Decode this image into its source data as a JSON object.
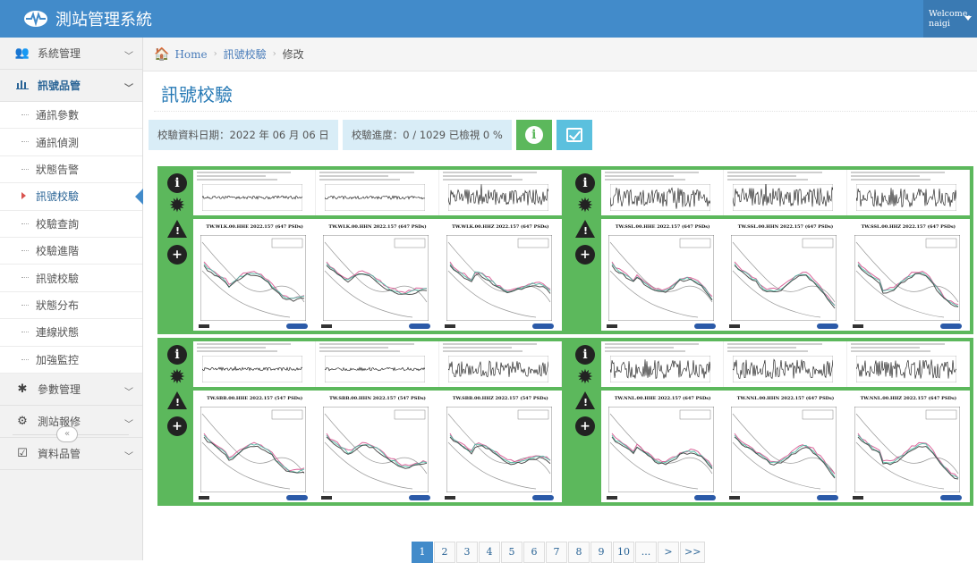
{
  "app": {
    "title": "測站管理系統",
    "welcome_line1": "Welcome,",
    "welcome_line2": "naigi"
  },
  "sidebar": {
    "groups": [
      {
        "label": "系統管理",
        "icon": "users-icon"
      },
      {
        "label": "訊號品管",
        "icon": "bar-chart-icon",
        "active": true
      },
      {
        "label": "參數管理",
        "icon": "asterisk-icon"
      },
      {
        "label": "測站報修",
        "icon": "cogs-icon"
      },
      {
        "label": "資料品管",
        "icon": "check-square-icon"
      }
    ],
    "subitems": [
      "通訊參數",
      "通訊偵測",
      "狀態告警",
      "訊號校驗",
      "校驗查詢",
      "校驗進階",
      "訊號校驗",
      "狀態分布",
      "連線狀態",
      "加強監控"
    ],
    "active_subitem": "訊號校驗",
    "collapse_glyph": "«"
  },
  "breadcrumb": {
    "home": "Home",
    "level1": "訊號校驗",
    "level2": "修改"
  },
  "page": {
    "title": "訊號校驗",
    "date_label": "校驗資料日期：2022 年 06 月 06 日",
    "progress_label": "校驗進度：0 / 1029 已檢視 0 %",
    "info_glyph": "i"
  },
  "cards": [
    {
      "titles": [
        "TW.WLK.00.HHE  2022.157  (647 PSDs)",
        "TW.WLK.00.HHN  2022.157  (647 PSDs)",
        "TW.WLK.00.HHZ  2022.157  (647 PSDs)"
      ]
    },
    {
      "titles": [
        "TW.SSL.00.HHE  2022.157  (647 PSDs)",
        "TW.SSL.00.HHN  2022.157  (647 PSDs)",
        "TW.SSL.00.HHZ  2022.157  (647 PSDs)"
      ]
    },
    {
      "titles": [
        "TW.SBB.00.HHE  2022.157  (547 PSDs)",
        "TW.SBB.00.HHN  2022.157  (547 PSDs)",
        "TW.SBB.00.HHZ  2022.157  (547 PSDs)"
      ]
    },
    {
      "titles": [
        "TW.NNL.00.HHE  2022.157  (647 PSDs)",
        "TW.NNL.00.HHN  2022.157  (647 PSDs)",
        "TW.NNL.00.HHZ  2022.157  (647 PSDs)"
      ]
    }
  ],
  "pagination": {
    "pages": [
      "1",
      "2",
      "3",
      "4",
      "5",
      "6",
      "7",
      "8",
      "9",
      "10",
      "...",
      ">",
      ">>"
    ],
    "active": "1"
  },
  "colors": {
    "topbar": "#428bca",
    "card_border": "#5cb85c",
    "info_box": "#d9edf7",
    "title": "#2679b5"
  }
}
